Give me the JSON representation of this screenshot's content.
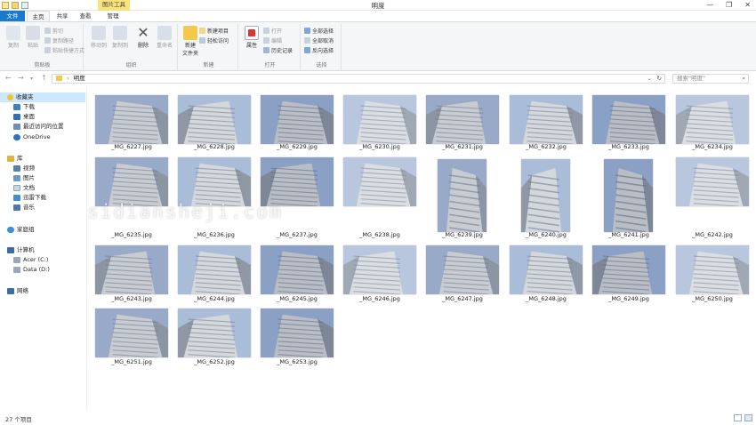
{
  "window": {
    "title": "明度",
    "context_tab": "图片工具",
    "controls": [
      "—",
      "❐",
      "✕"
    ]
  },
  "tabs": [
    {
      "label": "文件"
    },
    {
      "label": "主页"
    },
    {
      "label": "共享"
    },
    {
      "label": "查看"
    },
    {
      "label": "管理"
    }
  ],
  "ribbon": {
    "groups": [
      {
        "label": "剪贴板"
      },
      {
        "label": "组织"
      },
      {
        "label": "新建"
      },
      {
        "label": "打开"
      },
      {
        "label": "选择"
      }
    ],
    "pin": "固定到\"快速访问\"",
    "copy": "复制",
    "paste": "粘贴",
    "cut": "剪切",
    "copy_path": "复制路径",
    "paste_shortcut": "粘贴快捷方式",
    "move_to": "移动到",
    "copy_to": "复制到",
    "delete": "删除",
    "rename": "重命名",
    "new_folder": "新建\n文件夹",
    "new_item": "新建项目",
    "easy_access": "轻松访问",
    "properties": "属性",
    "open": "打开",
    "edit": "编辑",
    "history": "历史记录",
    "select_all": "全部选择",
    "select_none": "全部取消",
    "invert_select": "反向选择"
  },
  "address": {
    "path": "明度",
    "search_placeholder": "搜索\"明度\""
  },
  "nav": {
    "quick_access": "收藏夹",
    "items_fav": [
      "下载",
      "桌面",
      "最近访问的位置"
    ],
    "onedrive": "OneDrive",
    "library": "库",
    "items_lib": [
      "视频",
      "图片",
      "文档",
      "迅雷下载",
      "音乐"
    ],
    "homegroup": "家庭组",
    "computer": "计算机",
    "drives": [
      "Acer (C:)",
      "Data (D:)"
    ],
    "network": "网络"
  },
  "files": [
    "_MG_6227.jpg",
    "_MG_6228.jpg",
    "_MG_6229.jpg",
    "_MG_6230.jpg",
    "_MG_6231.jpg",
    "_MG_6232.jpg",
    "_MG_6233.jpg",
    "_MG_6234.jpg",
    "_MG_6235.jpg",
    "_MG_6236.jpg",
    "_MG_6237.jpg",
    "_MG_6238.jpg",
    "_MG_6239.jpg",
    "_MG_6240.jpg",
    "_MG_6241.jpg",
    "_MG_6242.jpg",
    "_MG_6243.jpg",
    "_MG_6244.jpg",
    "_MG_6245.jpg",
    "_MG_6246.jpg",
    "_MG_6247.jpg",
    "_MG_6248.jpg",
    "_MG_6249.jpg",
    "_MG_6250.jpg",
    "_MG_6251.jpg",
    "_MG_6252.jpg",
    "_MG_6253.jpg"
  ],
  "watermark": "sidiansheji.com",
  "status": {
    "count": "27 个项目"
  },
  "colors": {
    "file_tab": "#1979ca",
    "context_tab": "#f8e27a",
    "selection": "#cce8ff",
    "sky": "#9bb0cf"
  }
}
